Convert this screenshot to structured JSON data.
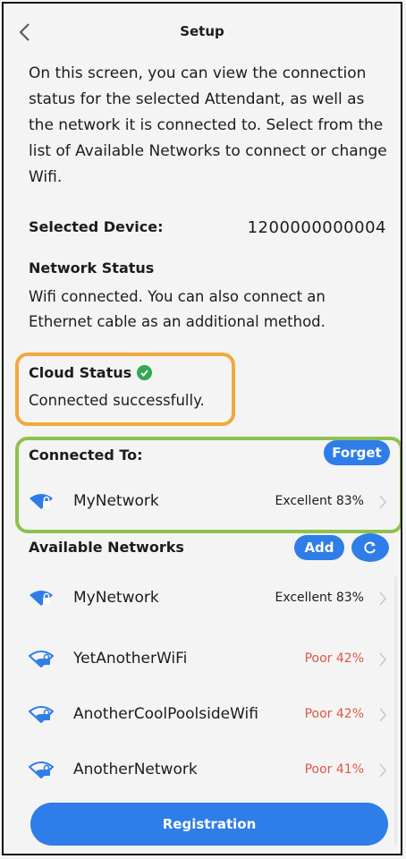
{
  "header": {
    "title": "Setup"
  },
  "intro": "On this screen, you can view the connection status for the selected Attendant, as well as the network it is connected to.  Select from the list of Available Networks to connect or change Wifi.",
  "selected_device": {
    "label": "Selected Device:",
    "value": "1200000000004"
  },
  "network_status": {
    "title": "Network Status",
    "text": "Wifi connected.  You can also connect an Ethernet cable as an additional method."
  },
  "cloud_status": {
    "title": "Cloud Status",
    "text": "Connected successfully."
  },
  "connected_to": {
    "title": "Connected To:",
    "forget_label": "Forget",
    "network": {
      "name": "MyNetwork",
      "signal": "Excellent 83%"
    }
  },
  "available": {
    "title": "Available Networks",
    "add_label": "Add",
    "networks": [
      {
        "name": "MyNetwork",
        "signal": "Excellent 83%",
        "quality": "good"
      },
      {
        "name": "YetAnotherWiFi",
        "signal": "Poor 42%",
        "quality": "poor"
      },
      {
        "name": "AnotherCoolPoolsideWifi",
        "signal": "Poor 42%",
        "quality": "poor"
      },
      {
        "name": "AnotherNetwork",
        "signal": "Poor 41%",
        "quality": "poor"
      }
    ]
  },
  "registration_label": "Registration",
  "colors": {
    "accent": "#2f7de8",
    "cloud_highlight": "#f2a93b",
    "connected_highlight": "#8dc24e",
    "poor_signal": "#e0564a",
    "success": "#33a852"
  },
  "icons": [
    "back-chevron-icon",
    "check-circle-icon",
    "wifi-lock-icon",
    "chevron-right-icon",
    "refresh-icon"
  ]
}
